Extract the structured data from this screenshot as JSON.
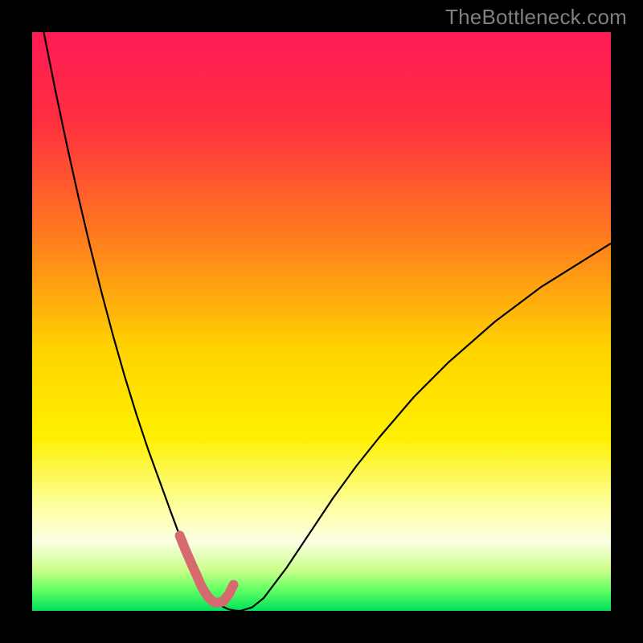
{
  "watermark": "TheBottleneck.com",
  "chart_data": {
    "type": "line",
    "title": "",
    "xlabel": "",
    "ylabel": "",
    "xlim": [
      0,
      100
    ],
    "ylim": [
      0,
      100
    ],
    "grid": false,
    "legend": false,
    "gradient_stops": [
      {
        "offset": 0.0,
        "color": "#ff1a55"
      },
      {
        "offset": 0.15,
        "color": "#ff2e40"
      },
      {
        "offset": 0.35,
        "color": "#ff7a1f"
      },
      {
        "offset": 0.55,
        "color": "#ffd400"
      },
      {
        "offset": 0.7,
        "color": "#fff000"
      },
      {
        "offset": 0.82,
        "color": "#fdffa0"
      },
      {
        "offset": 0.88,
        "color": "#fcffe4"
      },
      {
        "offset": 0.93,
        "color": "#c9ff8a"
      },
      {
        "offset": 0.965,
        "color": "#5fff62"
      },
      {
        "offset": 1.0,
        "color": "#00e05a"
      }
    ],
    "notch_x": 30,
    "series": [
      {
        "name": "curve",
        "color": "#000000",
        "width": 2.2,
        "x": [
          2,
          4,
          6,
          8,
          10,
          12,
          14,
          16,
          18,
          20,
          22,
          24,
          25,
          26,
          27,
          28,
          29,
          30,
          31,
          32,
          33,
          34,
          35,
          36,
          38,
          40,
          44,
          48,
          52,
          56,
          60,
          66,
          72,
          80,
          88,
          96,
          100
        ],
        "y": [
          100,
          90,
          80.5,
          71.5,
          63,
          55,
          47.5,
          40.5,
          34,
          28,
          22.5,
          17,
          14.3,
          11.8,
          9.5,
          7.3,
          5.3,
          3.7,
          2.4,
          1.4,
          0.7,
          0.25,
          0.05,
          0.0,
          0.6,
          2.2,
          7.5,
          13.5,
          19.5,
          25,
          30,
          37,
          43,
          50,
          56,
          61,
          63.5
        ]
      },
      {
        "name": "marker-band",
        "color": "#d66a6f",
        "width": 12,
        "linecap": "round",
        "x": [
          25.5,
          26.5,
          27.5,
          28.5,
          29.0,
          29.5,
          30.0,
          30.5,
          31.0,
          31.5,
          32.0,
          33.0,
          34.0,
          34.8
        ],
        "y": [
          13.0,
          10.5,
          8.2,
          6.0,
          4.8,
          3.8,
          3.0,
          2.3,
          1.8,
          1.5,
          1.4,
          1.6,
          2.9,
          4.5
        ]
      }
    ]
  }
}
